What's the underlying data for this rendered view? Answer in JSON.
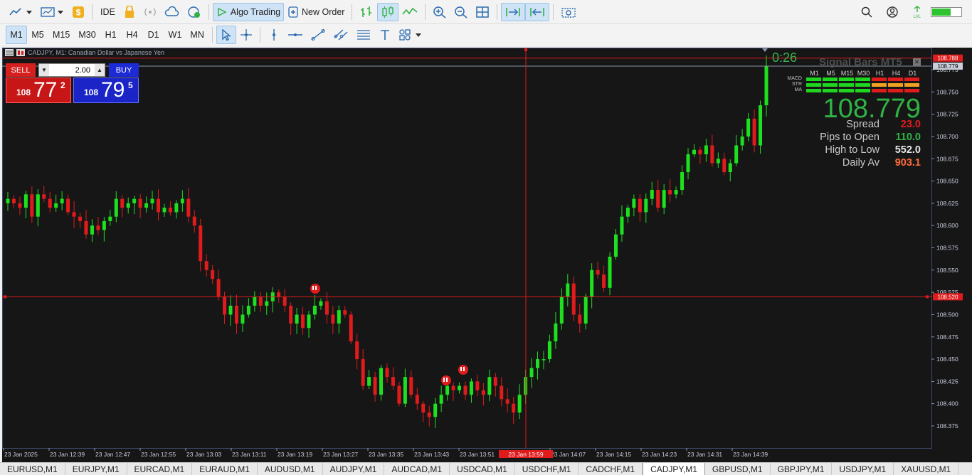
{
  "toolbar": {
    "ide_label": "IDE",
    "algo_trading_label": "Algo Trading",
    "new_order_label": "New Order"
  },
  "timeframes": [
    "M1",
    "M5",
    "M15",
    "M30",
    "H1",
    "H4",
    "D1",
    "W1",
    "MN"
  ],
  "active_timeframe": "M1",
  "chart": {
    "title": "CADJPY, M1:  Canadian Dollar vs Japanese Yen",
    "countdown": "0:26"
  },
  "trade_panel": {
    "sell_label": "SELL",
    "buy_label": "BUY",
    "lot": "2.00",
    "sell_prefix": "108",
    "sell_big": "77",
    "sell_sup": "2",
    "buy_prefix": "108",
    "buy_big": "79",
    "buy_sup": "5"
  },
  "signal_bars": {
    "title": "Signal Bars MT5",
    "timeframes": [
      "M1",
      "M5",
      "M15",
      "M30",
      "H1",
      "H4",
      "D1"
    ],
    "indicators": [
      {
        "name": "MACD",
        "colors": [
          "#1ed61e",
          "#1ed61e",
          "#1ed61e",
          "#1ed61e",
          "#e01b1b",
          "#e01b1b",
          "#e01b1b"
        ]
      },
      {
        "name": "STR",
        "colors": [
          "#1ed61e",
          "#1ed61e",
          "#1ed61e",
          "#1ed61e",
          "#f0a020",
          "#f0a020",
          "#f0a020"
        ]
      },
      {
        "name": "MA",
        "colors": [
          "#1ed61e",
          "#1ed61e",
          "#1ed61e",
          "#1ed61e",
          "#e01b1b",
          "#e01b1b",
          "#e01b1b"
        ]
      }
    ],
    "price": "108.779",
    "stats": [
      {
        "label": "Spread",
        "value": "23.0",
        "color": "#e41b1b"
      },
      {
        "label": "Pips to Open",
        "value": "110.0",
        "color": "#2fb344"
      },
      {
        "label": "High to Low",
        "value": "552.0",
        "color": "#e6e6e6"
      },
      {
        "label": "Daily Av",
        "value": "903.1",
        "color": "#ff6b3d"
      }
    ]
  },
  "price_axis": {
    "labels": [
      "108.775",
      "108.750",
      "108.725",
      "108.700",
      "108.675",
      "108.650",
      "108.625",
      "108.600",
      "108.575",
      "108.550",
      "108.525",
      "108.500",
      "108.475",
      "108.450",
      "108.425",
      "108.400",
      "108.375"
    ],
    "ask_tag": "108.788",
    "bid_tag": "108.779",
    "crosshair_tag": "108.520"
  },
  "time_axis": {
    "labels": [
      "23 Jan 2025",
      "23 Jan 12:39",
      "23 Jan 12:47",
      "23 Jan 12:55",
      "23 Jan 13:03",
      "23 Jan 13:11",
      "23 Jan 13:19",
      "23 Jan 13:27",
      "23 Jan 13:35",
      "23 Jan 13:43",
      "23 Jan 13:51",
      "23 Jan 14:07",
      "23 Jan 14:15",
      "23 Jan 14:23",
      "23 Jan 14:31",
      "23 Jan 14:39"
    ],
    "crosshair_tag": "23 Jan 13:59"
  },
  "symbol_tabs": [
    "EURUSD,M1",
    "EURJPY,M1",
    "EURCAD,M1",
    "EURAUD,M1",
    "AUDUSD,M1",
    "AUDJPY,M1",
    "AUDCAD,M1",
    "USDCAD,M1",
    "USDCHF,M1",
    "CADCHF,M1",
    "CADJPY,M1",
    "GBPUSD,M1",
    "GBPJPY,M1",
    "USDJPY,M1",
    "XAUUSD,M1"
  ],
  "active_symbol": "CADJPY,M1",
  "chart_data": {
    "type": "candlestick",
    "symbol": "CADJPY",
    "timeframe": "M1",
    "ylim": [
      108.36,
      108.8
    ],
    "bull_color": "#1ee01e",
    "bear_color": "#e01b1b",
    "crosshair_price": 108.52,
    "ask": 108.788,
    "bid": 108.779,
    "close": [
      108.63,
      108.625,
      108.62,
      108.635,
      108.61,
      108.635,
      108.63,
      108.62,
      108.625,
      108.63,
      108.615,
      108.61,
      108.605,
      108.59,
      108.6,
      108.595,
      108.605,
      108.61,
      108.63,
      108.62,
      108.625,
      108.63,
      108.62,
      108.625,
      108.63,
      108.615,
      108.62,
      108.615,
      108.625,
      108.63,
      108.61,
      108.6,
      108.56,
      108.55,
      108.54,
      108.52,
      108.5,
      108.51,
      108.49,
      108.5,
      108.51,
      108.52,
      108.51,
      108.515,
      108.525,
      108.52,
      108.51,
      108.49,
      108.5,
      108.485,
      108.5,
      108.51,
      108.515,
      108.5,
      108.49,
      108.505,
      108.5,
      108.47,
      108.45,
      108.42,
      108.43,
      108.41,
      108.44,
      108.43,
      108.42,
      108.4,
      108.43,
      108.41,
      108.4,
      108.39,
      108.385,
      108.4,
      108.41,
      108.42,
      108.415,
      108.42,
      108.41,
      108.425,
      108.415,
      108.41,
      108.43,
      108.42,
      108.405,
      108.4,
      108.39,
      108.41,
      108.43,
      108.44,
      108.45,
      108.45,
      108.47,
      108.49,
      108.52,
      108.535,
      108.5,
      108.49,
      108.52,
      108.55,
      108.545,
      108.53,
      108.565,
      108.59,
      108.61,
      108.62,
      108.63,
      108.615,
      108.63,
      108.64,
      108.62,
      108.64,
      108.635,
      108.64,
      108.66,
      108.68,
      108.685,
      108.68,
      108.69,
      108.67,
      108.675,
      108.66,
      108.67,
      108.69,
      108.7,
      108.72,
      108.69,
      108.735,
      108.779
    ]
  }
}
